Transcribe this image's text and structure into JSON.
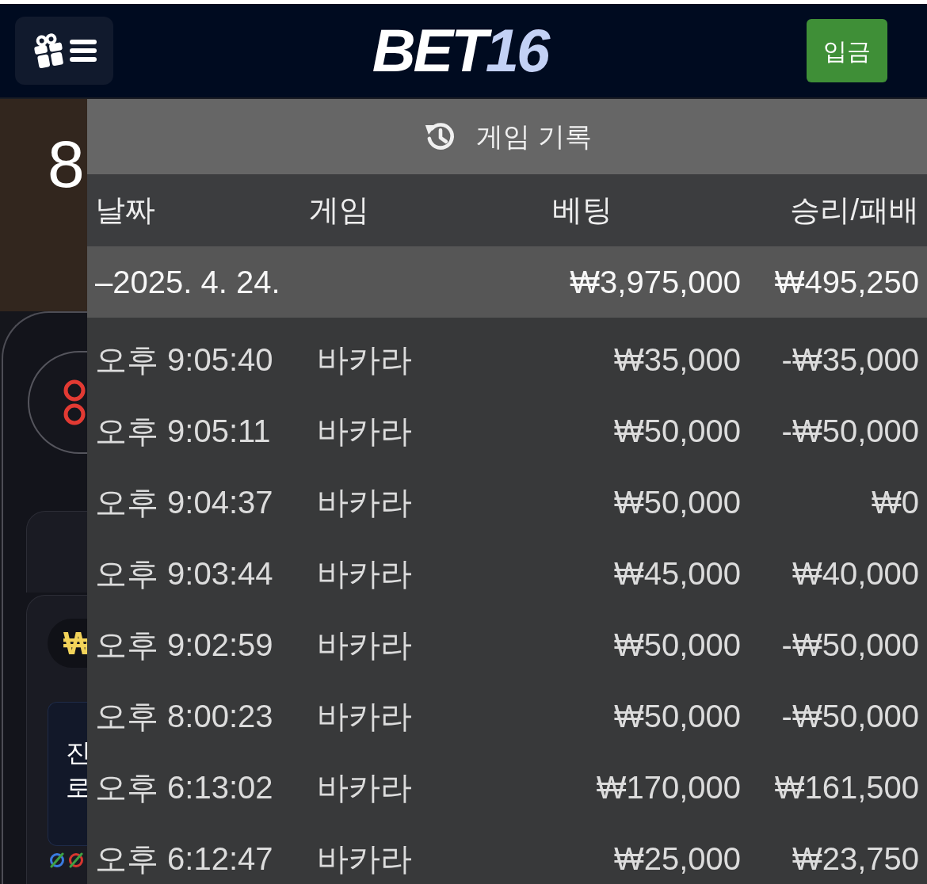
{
  "header": {
    "logo": {
      "text": "BET",
      "accent": "16"
    },
    "deposit_button": "입금"
  },
  "background_page": {
    "score_text": "8",
    "currency_symbol": "₩",
    "notice_lines": [
      "진",
      "로"
    ]
  },
  "history_panel": {
    "title": "게임 기록",
    "columns": [
      "날짜",
      "게임",
      "베팅",
      "승리/패배"
    ],
    "date_group": {
      "date": "–2025. 4. 24.",
      "bet": "₩3,975,000",
      "result": "₩495,250"
    },
    "rows": [
      {
        "time": "오후 9:05:40",
        "game": "바카라",
        "bet": "₩35,000",
        "result": "-₩35,000"
      },
      {
        "time": "오후 9:05:11",
        "game": "바카라",
        "bet": "₩50,000",
        "result": "-₩50,000"
      },
      {
        "time": "오후 9:04:37",
        "game": "바카라",
        "bet": "₩50,000",
        "result": "₩0"
      },
      {
        "time": "오후 9:03:44",
        "game": "바카라",
        "bet": "₩45,000",
        "result": "₩40,000"
      },
      {
        "time": "오후 9:02:59",
        "game": "바카라",
        "bet": "₩50,000",
        "result": "-₩50,000"
      },
      {
        "time": "오후 8:00:23",
        "game": "바카라",
        "bet": "₩50,000",
        "result": "-₩50,000"
      },
      {
        "time": "오후 6:13:02",
        "game": "바카라",
        "bet": "₩170,000",
        "result": "₩161,500"
      },
      {
        "time": "오후 6:12:47",
        "game": "바카라",
        "bet": "₩25,000",
        "result": "₩23,750"
      }
    ]
  }
}
